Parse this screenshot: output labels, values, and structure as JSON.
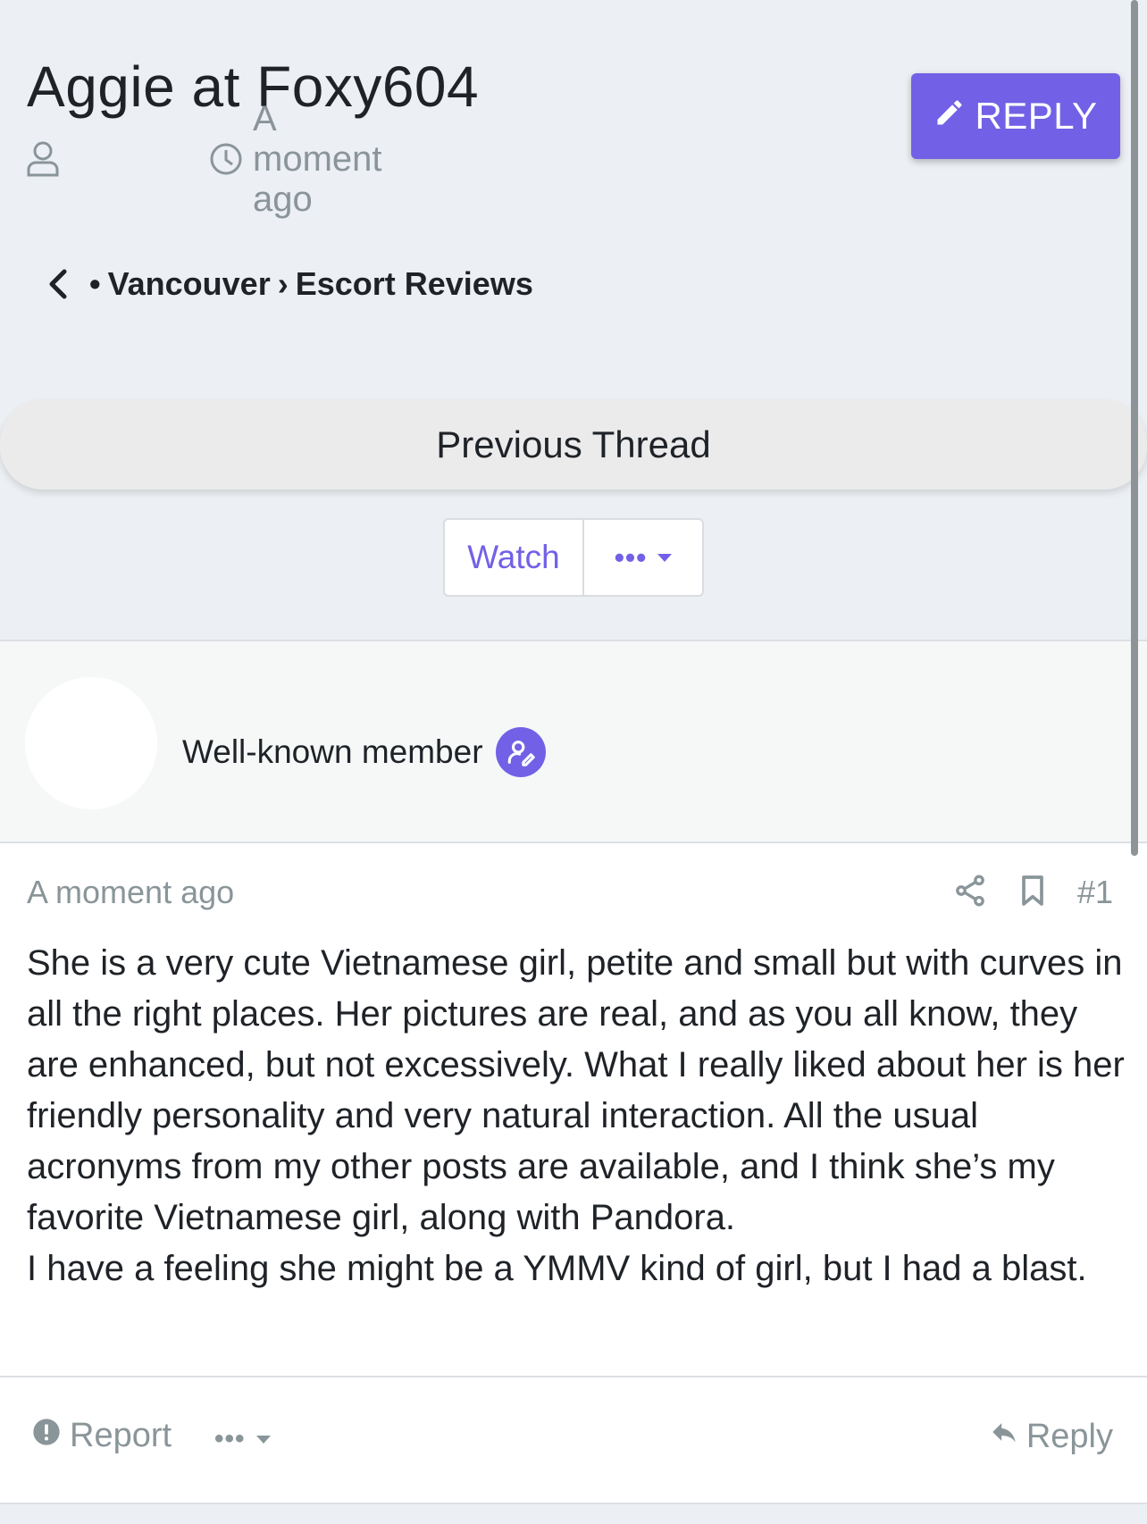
{
  "thread": {
    "title": "Aggie at Foxy604",
    "author_name": "",
    "timestamp": "A moment ago",
    "reply_button_label": "REPLY"
  },
  "breadcrumb": {
    "bullet": "•",
    "items": [
      "Vancouver",
      "Escort Reviews"
    ],
    "separator": "›"
  },
  "navigation": {
    "previous_thread_label": "Previous Thread",
    "watch_label": "Watch",
    "more_label": "•••"
  },
  "user": {
    "name": "",
    "title": "Well-known member"
  },
  "post": {
    "timestamp": "A moment ago",
    "number": "#1",
    "paragraphs": [
      "She is a very cute Vietnamese girl, petite and small but with curves in all the right places. Her pictures are real, and as you all know, they are enhanced, but not excessively. What I really liked about her is her friendly personality and very natural interaction. All the usual acronyms from my other posts are available, and I think she’s my favorite Vietnamese girl, along with Pandora.",
      "I have a feeling she might be a YMMV kind of girl, but I had a blast."
    ]
  },
  "post_footer": {
    "report_label": "Report",
    "more_label": "•••",
    "reply_label": "Reply"
  },
  "colors": {
    "accent": "#7261e6",
    "page_bg": "#eceff3",
    "muted_text": "#8a9599"
  }
}
